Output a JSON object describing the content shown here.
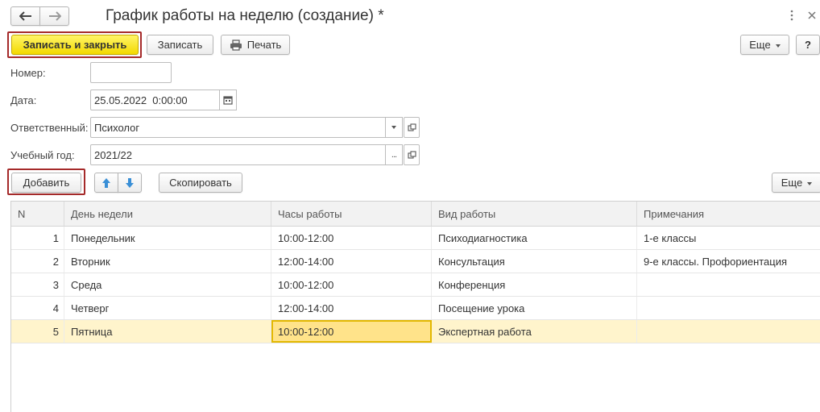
{
  "window": {
    "title": "График работы на неделю (создание) *",
    "menu_icon": "vertical-dots-icon",
    "close_icon": "close-icon"
  },
  "nav": {
    "back_icon": "arrow-left-icon",
    "forward_icon": "arrow-right-icon"
  },
  "toolbar": {
    "save_close_label": "Записать и закрыть",
    "save_label": "Записать",
    "print_label": "Печать",
    "more_label": "Еще",
    "help_label": "?"
  },
  "form": {
    "number_label": "Номер:",
    "number_value": "",
    "date_label": "Дата:",
    "date_value": "25.05.2022  0:00:00",
    "responsible_label": "Ответственный:",
    "responsible_value": "Психолог",
    "year_label": "Учебный год:",
    "year_value": "2021/22"
  },
  "table_toolbar": {
    "add_label": "Добавить",
    "copy_label": "Скопировать",
    "more_label": "Еще"
  },
  "table": {
    "columns": [
      "N",
      "День недели",
      "Часы работы",
      "Вид работы",
      "Примечания"
    ],
    "rows": [
      {
        "n": "1",
        "day": "Понедельник",
        "hours": "10:00-12:00",
        "work": "Психодиагностика",
        "note": "1-е классы"
      },
      {
        "n": "2",
        "day": "Вторник",
        "hours": "12:00-14:00",
        "work": "Консультация",
        "note": "9-е классы. Профориентация"
      },
      {
        "n": "3",
        "day": "Среда",
        "hours": "10:00-12:00",
        "work": "Конференция",
        "note": ""
      },
      {
        "n": "4",
        "day": "Четверг",
        "hours": "12:00-14:00",
        "work": "Посещение урока",
        "note": ""
      },
      {
        "n": "5",
        "day": "Пятница",
        "hours": "10:00-12:00",
        "work": "Экспертная работа",
        "note": ""
      }
    ],
    "selected_row": 5
  },
  "colors": {
    "primary_button": "#f3d900",
    "highlight_frame": "#a52a2a",
    "selected_row": "#fff4cc",
    "active_cell": "#ffe38a",
    "arrow_blue": "#3a8fd6"
  }
}
